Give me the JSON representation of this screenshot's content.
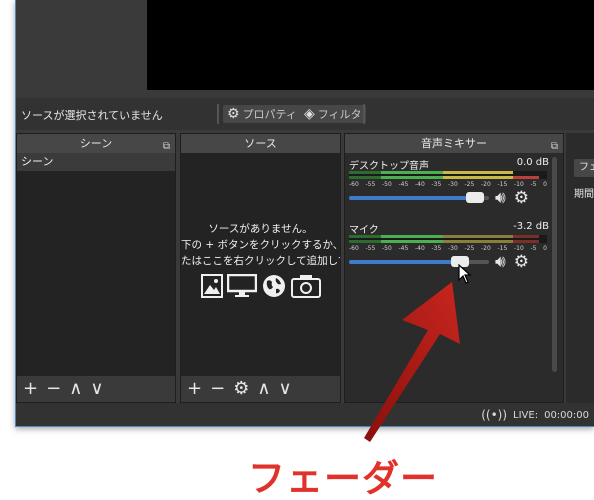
{
  "source_toolbar": {
    "no_source": "ソースが選択されていません",
    "properties": "プロパティ",
    "filters": "フィルタ"
  },
  "scenes": {
    "title": "シーン",
    "items": [
      "シーン"
    ],
    "footer": [
      "+",
      "−",
      "∧",
      "∨"
    ]
  },
  "sources": {
    "title": "ソース",
    "empty_lines": [
      "ソースがありません。",
      "下の + ボタンをクリックするか、",
      "たはここを右クリックして追加してくださ"
    ],
    "footer": [
      "+",
      "−",
      "⚙",
      "∧",
      "∨"
    ]
  },
  "mixer": {
    "title": "音声ミキサー",
    "ticks": [
      "-60",
      "-55",
      "-50",
      "-45",
      "-40",
      "-35",
      "-30",
      "-25",
      "-20",
      "-15",
      "-10",
      "-5",
      "0"
    ],
    "channels": [
      {
        "name": "デスクトップ音声",
        "db": "0.0 dB",
        "level": 0.9
      },
      {
        "name": "マイク",
        "db": "-3.2 dB",
        "level": 0.79
      }
    ]
  },
  "right_dock": {
    "button": "フェ",
    "label": "期間"
  },
  "status": {
    "live_label": "LIVE:",
    "live_time": "00:00:00"
  },
  "annotation": {
    "caption": "フェーダー"
  },
  "colors": {
    "accent_blue": "#3d7cc9",
    "meter_green": "#4caf50",
    "meter_yellow": "#c8b84a",
    "meter_red": "#b9413b",
    "caption_red": "#e0322a",
    "arrow_red": "#b01a14"
  }
}
